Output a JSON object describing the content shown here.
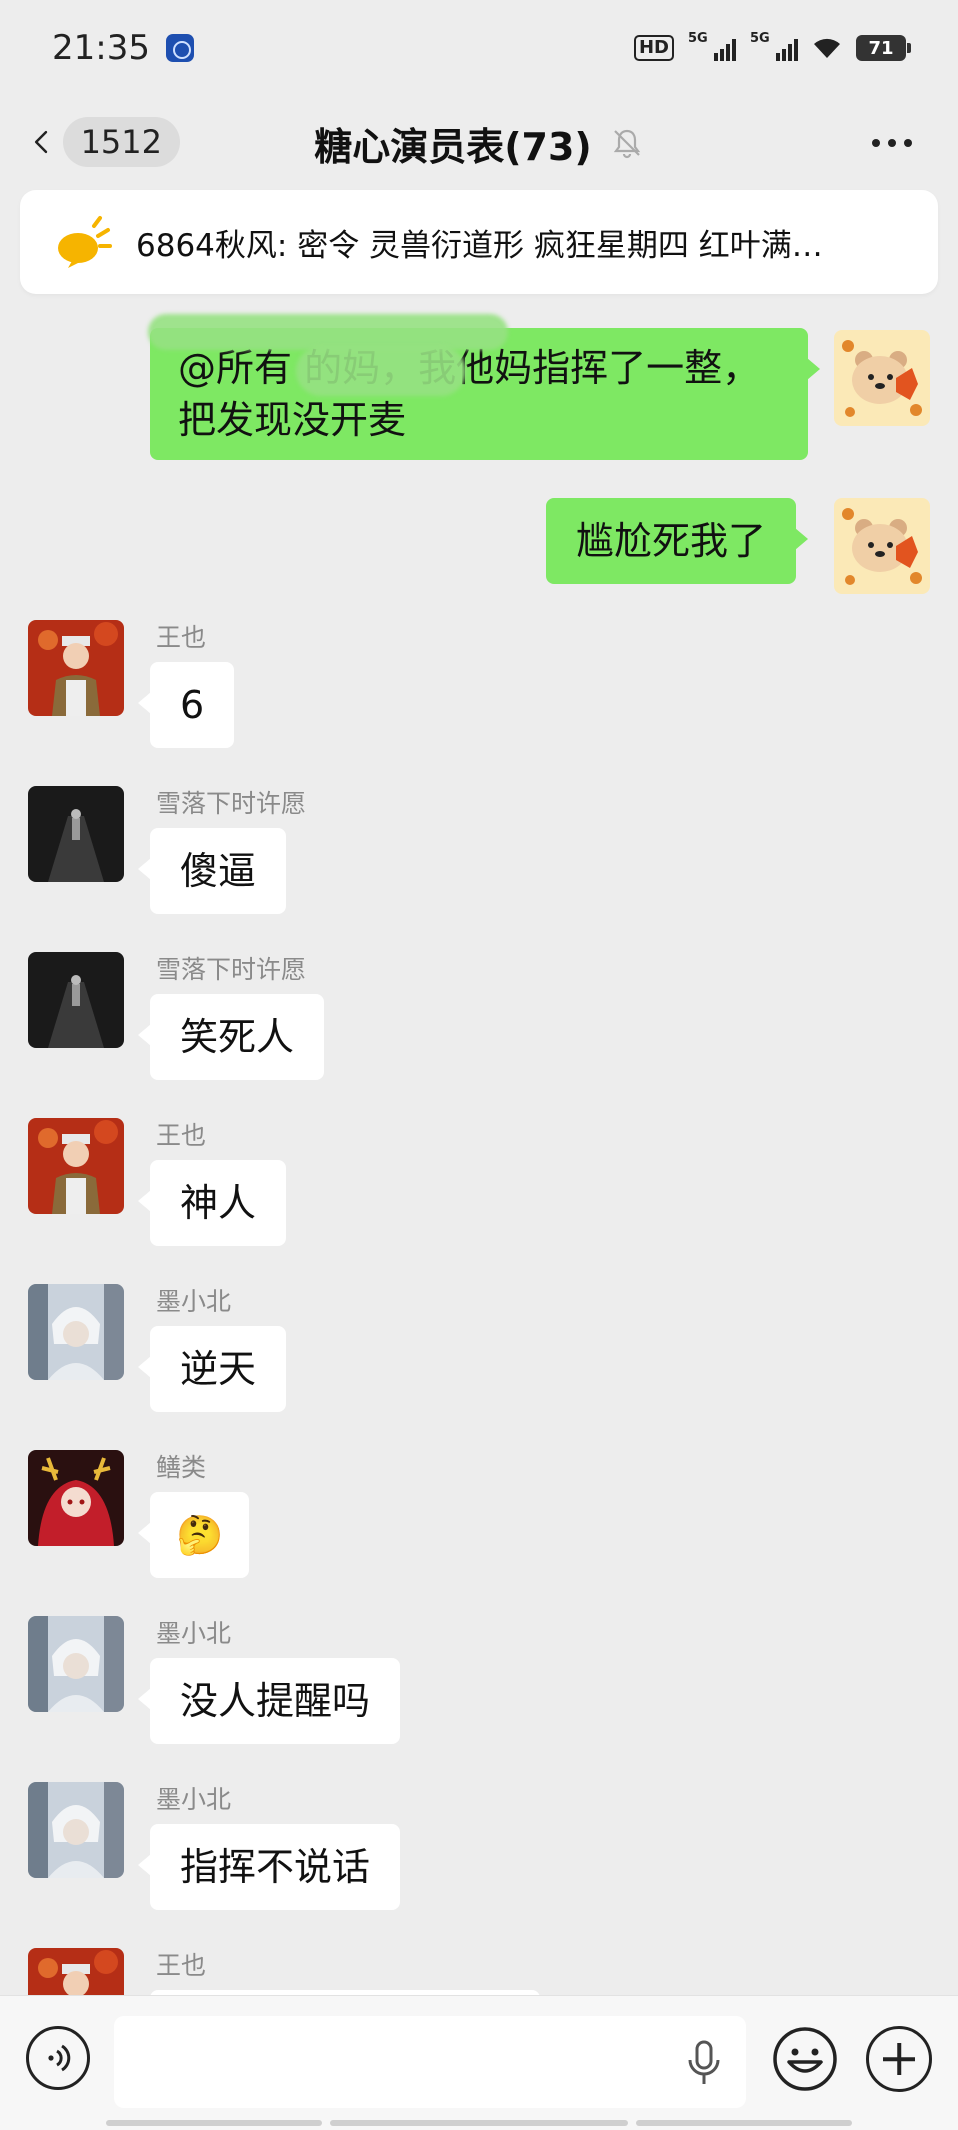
{
  "status_bar": {
    "time": "21:35",
    "hd_label": "HD",
    "network_1": "5G",
    "network_2": "5G",
    "battery": "71"
  },
  "header": {
    "unread_count": "1512",
    "title": "糖心演员表(73)",
    "muted": true
  },
  "notice": {
    "icon": "bulletin-speaker-icon",
    "text": "6864秋风: 密令 灵兽衍道形 疯狂星期四 红叶满…"
  },
  "messages": [
    {
      "side": "right",
      "text": "@所有         的妈，我他妈指挥了一整，把发现没开麦",
      "avatar": "bear-maple-avatar"
    },
    {
      "side": "right",
      "text": "尴尬死我了",
      "avatar": "bear-maple-avatar"
    },
    {
      "side": "left",
      "sender": "王也",
      "text": "6",
      "avatar": "red-leaf-boy-avatar"
    },
    {
      "side": "left",
      "sender": "雪落下时许愿",
      "text": "傻逼",
      "avatar": "dark-corridor-avatar"
    },
    {
      "side": "left",
      "sender": "雪落下时许愿",
      "text": "笑死人",
      "avatar": "dark-corridor-avatar"
    },
    {
      "side": "left",
      "sender": "王也",
      "text": "神人",
      "avatar": "red-leaf-boy-avatar"
    },
    {
      "side": "left",
      "sender": "墨小北",
      "text": "逆天",
      "avatar": "white-hair-avatar"
    },
    {
      "side": "left",
      "sender": "鳝类",
      "text": "🤔",
      "avatar": "red-antler-avatar"
    },
    {
      "side": "left",
      "sender": "墨小北",
      "text": "没人提醒吗",
      "avatar": "white-hair-avatar"
    },
    {
      "side": "left",
      "sender": "墨小北",
      "text": "指挥不说话",
      "avatar": "white-hair-avatar"
    },
    {
      "side": "left",
      "sender": "王也",
      "text": "",
      "avatar": "red-leaf-boy-avatar"
    }
  ],
  "input_bar": {
    "placeholder": ""
  }
}
